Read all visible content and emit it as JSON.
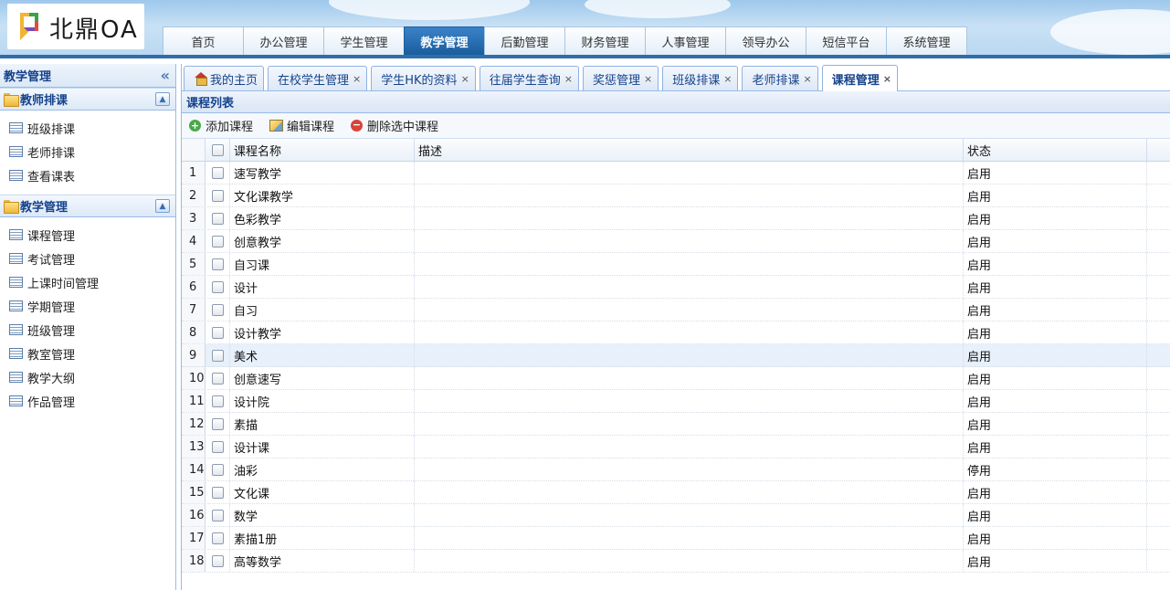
{
  "header": {
    "logo_text": "北鼎OA",
    "nav": [
      "首页",
      "办公管理",
      "学生管理",
      "教学管理",
      "后勤管理",
      "财务管理",
      "人事管理",
      "领导办公",
      "短信平台",
      "系统管理"
    ],
    "active_nav": "教学管理"
  },
  "sidebar": {
    "title": "教学管理",
    "collapse_icon": "«",
    "groups": [
      {
        "title": "教师排课",
        "toggle": "▲",
        "items": [
          "班级排课",
          "老师排课",
          "查看课表"
        ]
      },
      {
        "title": "教学管理",
        "toggle": "▲",
        "items": [
          "课程管理",
          "考试管理",
          "上课时间管理",
          "学期管理",
          "班级管理",
          "教室管理",
          "教学大纲",
          "作品管理"
        ]
      }
    ]
  },
  "tabs": {
    "home": "我的主页",
    "items": [
      "在校学生管理",
      "学生HK的资料",
      "往届学生查询",
      "奖惩管理",
      "班级排课",
      "老师排课",
      "课程管理"
    ],
    "active": "课程管理",
    "close_glyph": "×"
  },
  "panel": {
    "title": "课程列表",
    "toolbar": {
      "add": "添加课程",
      "edit": "编辑课程",
      "delete": "删除选中课程"
    },
    "columns": {
      "name": "课程名称",
      "desc": "描述",
      "status": "状态"
    },
    "rows": [
      {
        "num": "1",
        "name": "速写教学",
        "desc": "",
        "status": "启用"
      },
      {
        "num": "2",
        "name": "文化课教学",
        "desc": "",
        "status": "启用"
      },
      {
        "num": "3",
        "name": "色彩教学",
        "desc": "",
        "status": "启用"
      },
      {
        "num": "4",
        "name": "创意教学",
        "desc": "",
        "status": "启用"
      },
      {
        "num": "5",
        "name": "自习课",
        "desc": "",
        "status": "启用"
      },
      {
        "num": "6",
        "name": "设计",
        "desc": "",
        "status": "启用"
      },
      {
        "num": "7",
        "name": "自习",
        "desc": "",
        "status": "启用"
      },
      {
        "num": "8",
        "name": "设计教学",
        "desc": "",
        "status": "启用"
      },
      {
        "num": "9",
        "name": "美术",
        "desc": "",
        "status": "启用"
      },
      {
        "num": "10",
        "name": "创意速写",
        "desc": "",
        "status": "启用"
      },
      {
        "num": "11",
        "name": "设计院",
        "desc": "",
        "status": "启用"
      },
      {
        "num": "12",
        "name": "素描",
        "desc": "",
        "status": "启用"
      },
      {
        "num": "13",
        "name": "设计课",
        "desc": "",
        "status": "启用"
      },
      {
        "num": "14",
        "name": "油彩",
        "desc": "",
        "status": "停用"
      },
      {
        "num": "15",
        "name": "文化课",
        "desc": "",
        "status": "启用"
      },
      {
        "num": "16",
        "name": "数学",
        "desc": "",
        "status": "启用"
      },
      {
        "num": "17",
        "name": "素描1册",
        "desc": "",
        "status": "启用"
      },
      {
        "num": "18",
        "name": "高等数学",
        "desc": "",
        "status": "启用"
      }
    ],
    "highlight_row": 9
  }
}
